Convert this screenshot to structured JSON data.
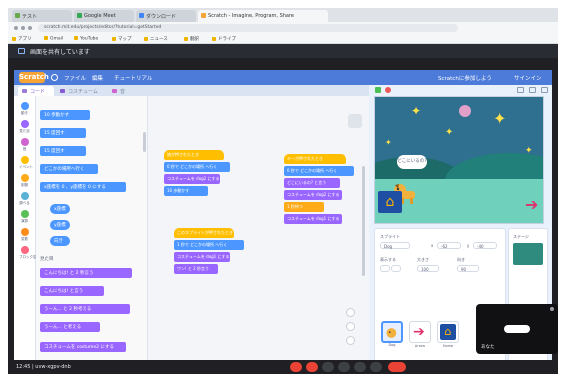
{
  "browser": {
    "tabs": [
      "テスト",
      "Google Meet",
      "ダウンロード",
      "Scratch - Imagine, Program, Share"
    ],
    "url": "scratch.mit.edu/projects/editor/?tutorial=getStarted",
    "bookmarks": [
      "アプリ",
      "Gmail",
      "YouTube",
      "マップ",
      "ニュース",
      "翻訳",
      "ドライブ"
    ]
  },
  "share_banner": {
    "text": "画面を共有しています"
  },
  "scratch": {
    "logo": "Scratch",
    "menu": [
      "ファイル",
      "編集",
      "チュートリアル"
    ],
    "menu_right": [
      "Scratchに参加しよう",
      "サインイン"
    ],
    "editor_tabs": [
      "コード",
      "コスチューム",
      "音"
    ],
    "categories": [
      {
        "label": "動き",
        "color": "#4c97ff"
      },
      {
        "label": "見た目",
        "color": "#9966ff"
      },
      {
        "label": "音",
        "color": "#cf63cf"
      },
      {
        "label": "イベント",
        "color": "#ffbf00"
      },
      {
        "label": "制御",
        "color": "#ffab19"
      },
      {
        "label": "調べる",
        "color": "#5cb1d6"
      },
      {
        "label": "演算",
        "color": "#59c059"
      },
      {
        "label": "変数",
        "color": "#ff8c1a"
      },
      {
        "label": "ブロック定義",
        "color": "#ff6680"
      }
    ],
    "palette_section": "見た目",
    "palette": {
      "motion": [
        "10 歩動かす",
        "15 度回す",
        "15 度回す",
        "どこかの場所へ行く",
        "x座標を 0 、y座標を 0 にする"
      ],
      "reporters": [
        "x座標",
        "y座標",
        "向き"
      ],
      "looks": [
        "こんにちは! と 2 秒言う",
        "こんにちは! と言う",
        "うーん... と 2 秒考える",
        "うーん... と考える",
        "コスチュームを costume2 にする"
      ]
    },
    "scripts": {
      "a": [
        "旗が押されたとき",
        "0 秒で どこかの場所 へ行く",
        "コスチュームを dog2 にする",
        "10 歩動かす"
      ],
      "b": [
        "このスプライトが押されたとき",
        "1 秒で どこかの場所 へ行く",
        "コスチュームを dog1 にする",
        "ワン! と 2 秒言う"
      ],
      "c": [
        "キーが押されたとき",
        "0 秒で どこかの場所 へ行く",
        "どこにいるの? と言う",
        "コスチュームを dog2 にする",
        "1 秒待つ",
        "コスチュームを dog1 にする"
      ]
    },
    "stage": {
      "speech": "どこにいるの?"
    },
    "sprite_info": {
      "sprite_label": "スプライト",
      "sprite_name": "Dog",
      "x_label": "x",
      "x_value": "-62",
      "y_label": "y",
      "y_value": "-40",
      "show_label": "表示する",
      "size_label": "大きさ",
      "size_value": "100",
      "direction_label": "向き",
      "direction_value": "90"
    },
    "sprites": [
      "Dog",
      "Arrow",
      "Home"
    ],
    "stage_pane_label": "ステージ"
  },
  "self_view": {
    "name": "あなた"
  },
  "meet_controls": {
    "time_and_code": "12:45 | uvw-xgpv-dnb"
  }
}
